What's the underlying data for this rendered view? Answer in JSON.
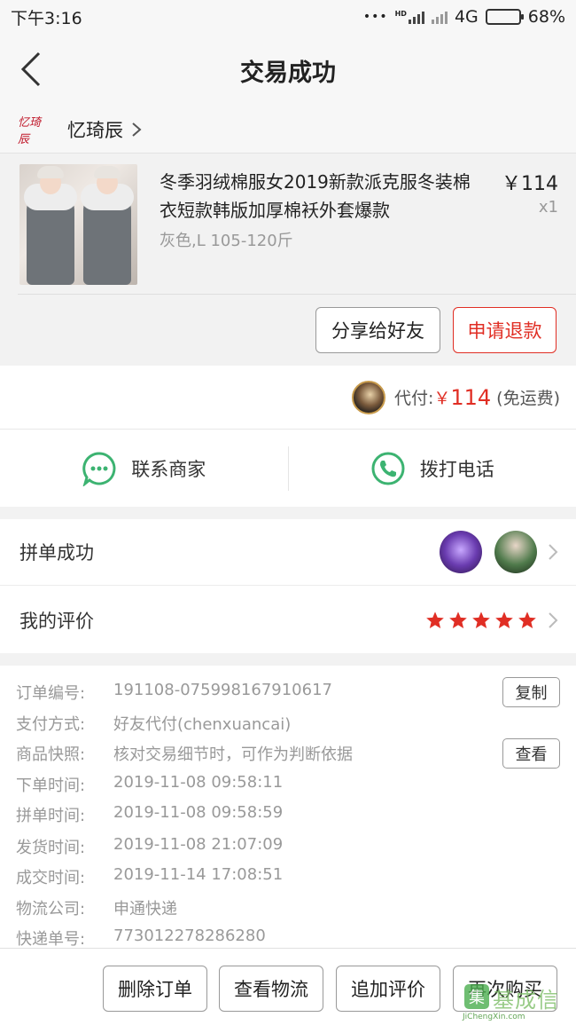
{
  "status_bar": {
    "time": "下午3:16",
    "dots": "•••",
    "network": "4G",
    "battery": "68%",
    "hd": "HD"
  },
  "header": {
    "title": "交易成功"
  },
  "shop": {
    "logo_text": "忆琦辰",
    "name": "忆琦辰"
  },
  "product": {
    "title": "冬季羽绒棉服女2019新款派克服冬装棉衣短款韩版加厚棉袄外套爆款",
    "spec": "灰色,L 105-120斤",
    "price": "￥114",
    "qty": "x1",
    "share_label": "分享给好友",
    "refund_label": "申请退款"
  },
  "payment": {
    "label": "代付:",
    "currency": "￥",
    "amount": "114",
    "note": "(免运费)"
  },
  "contact": {
    "merchant_label": "联系商家",
    "phone_label": "拨打电话"
  },
  "group": {
    "label": "拼单成功"
  },
  "review": {
    "label": "我的评价",
    "stars": 5
  },
  "order_info": [
    {
      "key": "订单编号:",
      "value": "191108-075998167910617",
      "button": "复制"
    },
    {
      "key": "支付方式:",
      "value": "好友代付(chenxuancai)"
    },
    {
      "key": "商品快照:",
      "value": "核对交易细节时，可作为判断依据",
      "button": "查看"
    },
    {
      "key": "下单时间:",
      "value": "2019-11-08 09:58:11"
    },
    {
      "key": "拼单时间:",
      "value": "2019-11-08 09:58:59"
    },
    {
      "key": "发货时间:",
      "value": "2019-11-08 21:07:09"
    },
    {
      "key": "成交时间:",
      "value": "2019-11-14 17:08:51"
    },
    {
      "key": "物流公司:",
      "value": "申通快递"
    },
    {
      "key": "快递单号:",
      "value": "773012278286280"
    }
  ],
  "bottom_actions": [
    "删除订单",
    "查看物流",
    "追加评价",
    "再次购买"
  ],
  "watermark": {
    "text": "JiChengXin.com",
    "big": "基成信"
  },
  "colors": {
    "accent": "#e02e24",
    "green": "#3cb371",
    "star": "#e02e24"
  }
}
